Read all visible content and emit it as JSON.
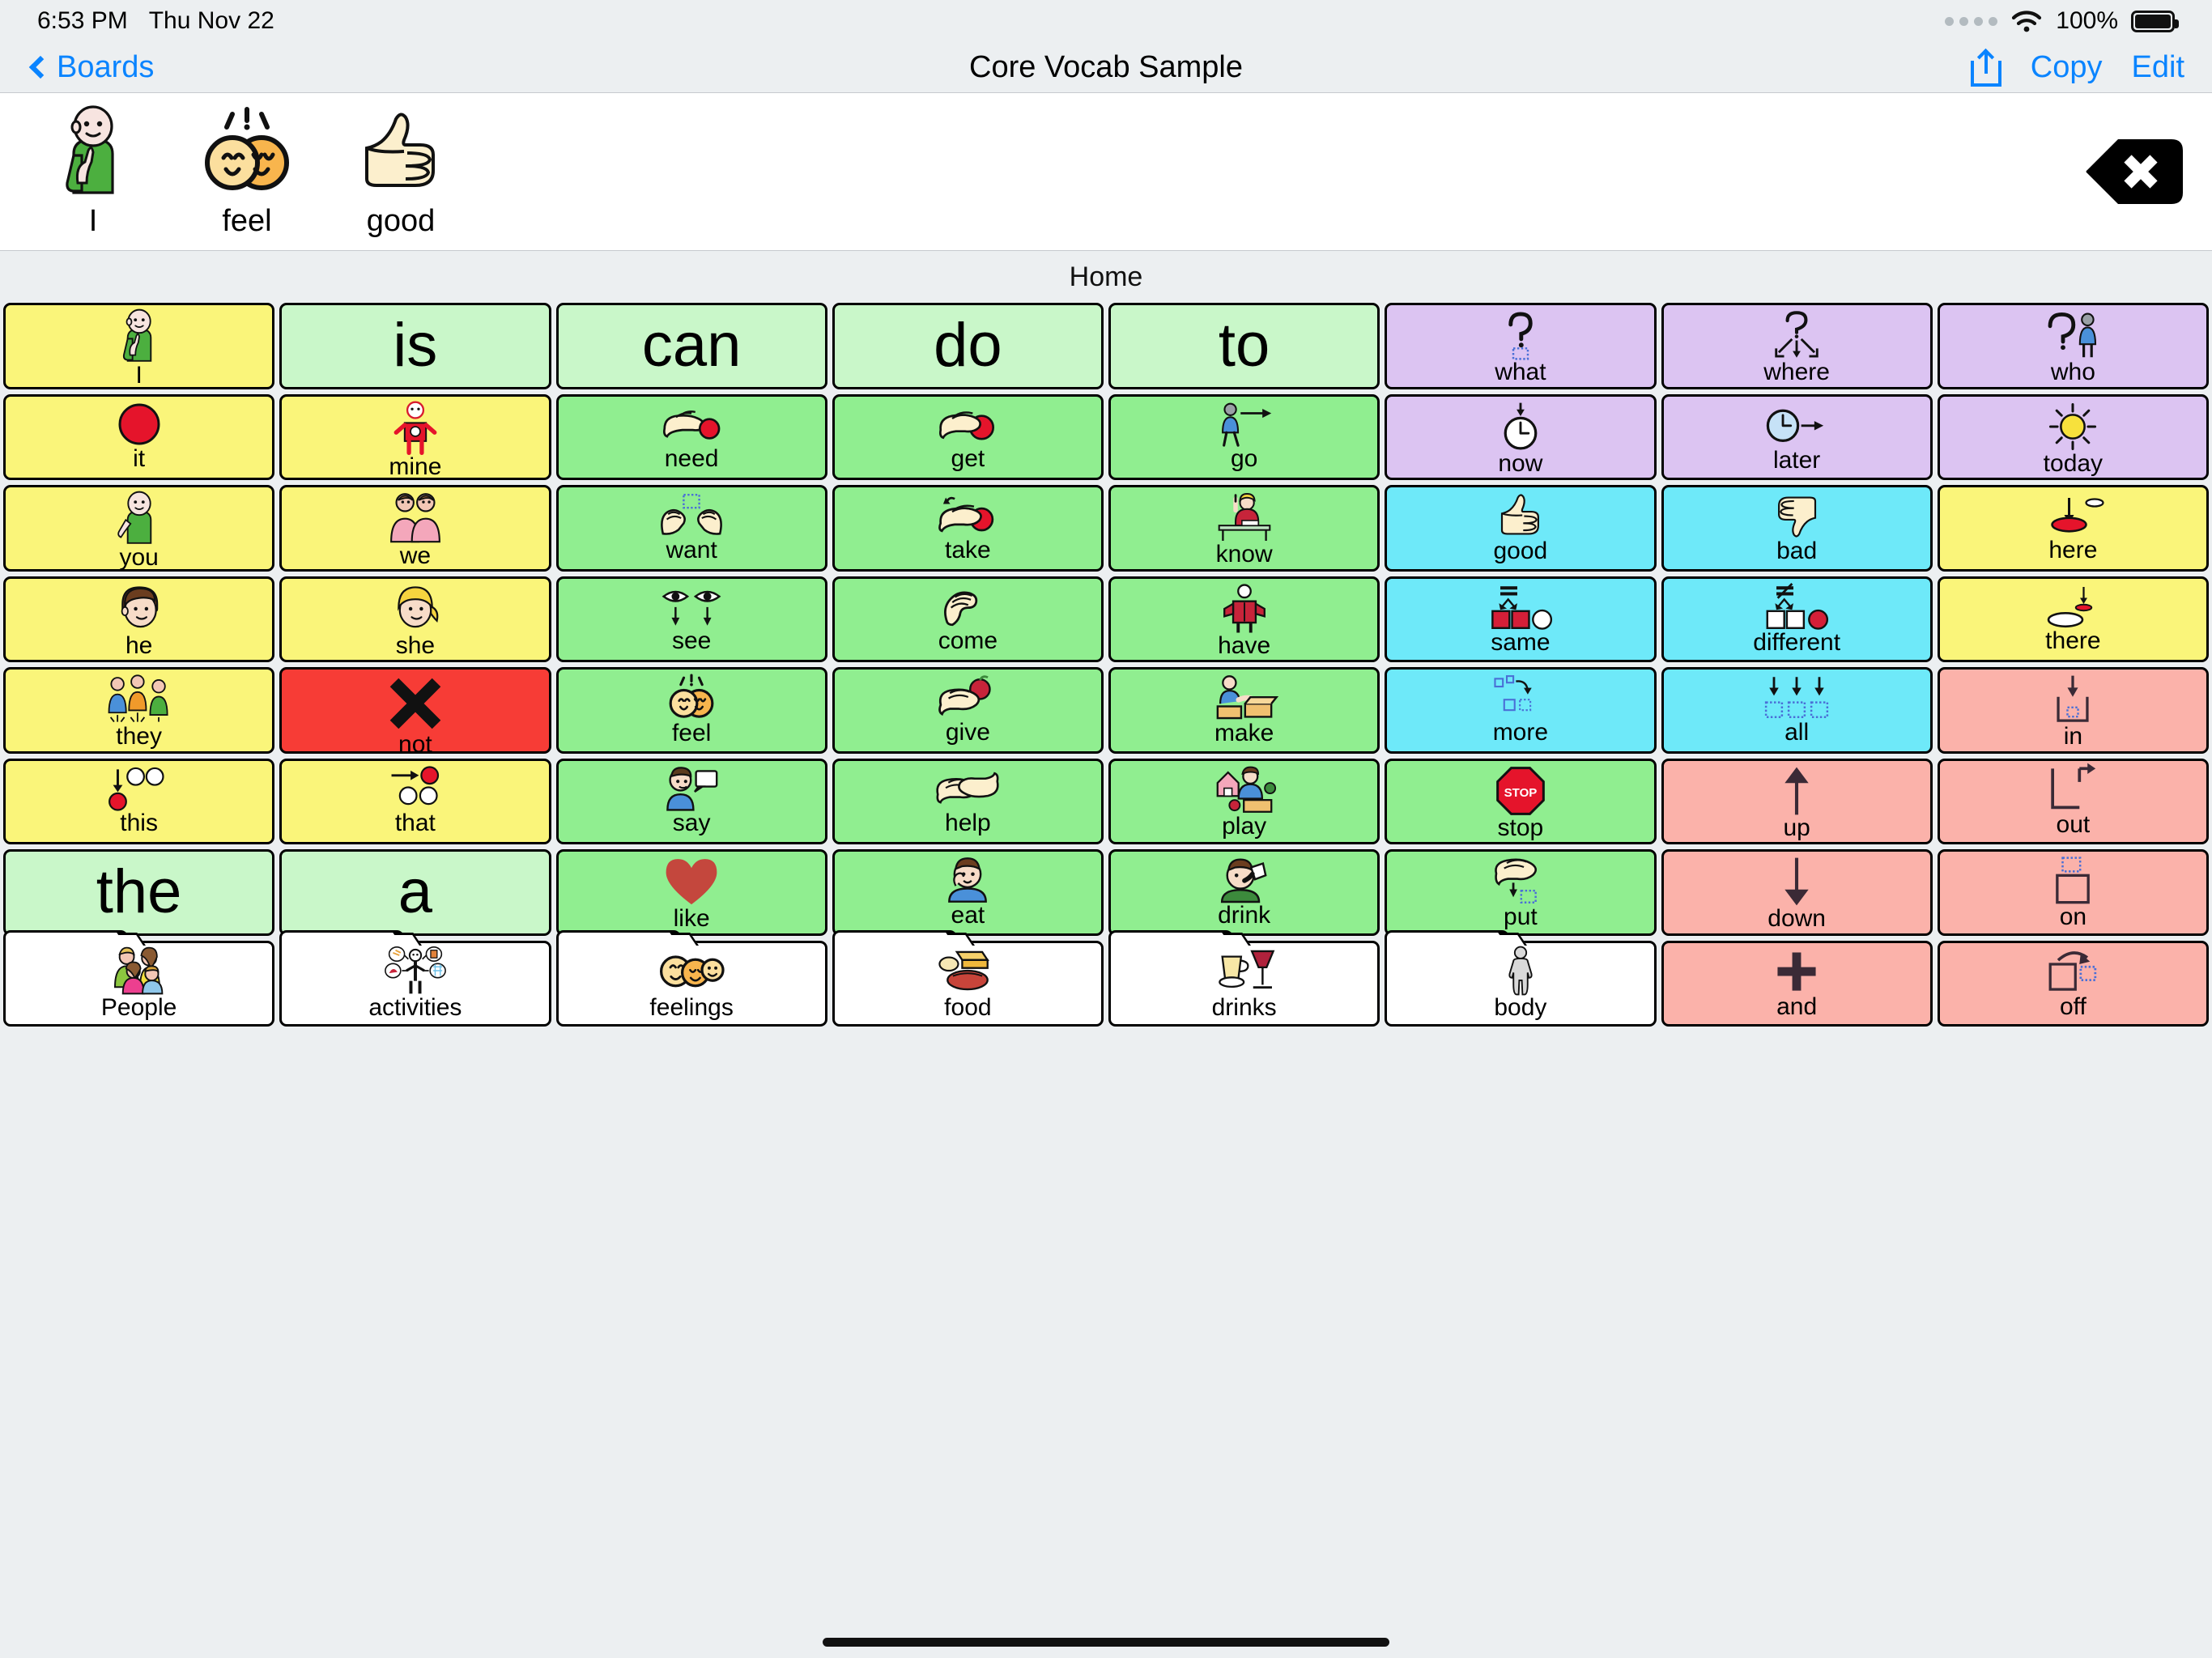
{
  "status_bar": {
    "time": "6:53 PM",
    "date": "Thu Nov 22",
    "battery_percent": "100%",
    "wifi_icon": "wifi-icon",
    "battery_icon": "battery-icon",
    "signal_icon": "signal-dots-icon"
  },
  "nav_bar": {
    "back_label": "Boards",
    "back_icon": "chevron-left-icon",
    "title": "Core Vocab Sample",
    "share_icon": "share-icon",
    "copy_label": "Copy",
    "edit_label": "Edit"
  },
  "message_bar": {
    "items": [
      {
        "label": "I",
        "symbol": "person-pointing-self-symbol"
      },
      {
        "label": "feel",
        "symbol": "two-faces-feeling-symbol"
      },
      {
        "label": "good",
        "symbol": "thumbs-up-symbol"
      }
    ],
    "delete_icon": "backspace-delete-icon"
  },
  "board": {
    "name": "Home",
    "columns": 8,
    "colors": {
      "pronoun_yellow": "#faf57a",
      "article_mint": "#c9f7c9",
      "verb_green": "#90ee90",
      "question_purple": "#dcc4f2",
      "descriptor_cyan": "#6ee9f9",
      "preposition_pink": "#fbb2aa",
      "negation_red": "#f73c36",
      "folder_white": "#ffffff"
    },
    "cells": [
      {
        "label": "I",
        "symbol": "person-pointing-self-symbol",
        "color": "pronoun_yellow",
        "style": "symbol"
      },
      {
        "label": "is",
        "symbol": "",
        "color": "article_mint",
        "style": "word"
      },
      {
        "label": "can",
        "symbol": "",
        "color": "article_mint",
        "style": "word"
      },
      {
        "label": "do",
        "symbol": "",
        "color": "article_mint",
        "style": "word"
      },
      {
        "label": "to",
        "symbol": "",
        "color": "article_mint",
        "style": "word"
      },
      {
        "label": "what",
        "symbol": "question-mark-box-symbol",
        "color": "question_purple",
        "style": "symbol"
      },
      {
        "label": "where",
        "symbol": "question-mark-arrows-symbol",
        "color": "question_purple",
        "style": "symbol"
      },
      {
        "label": "who",
        "symbol": "question-mark-person-symbol",
        "color": "question_purple",
        "style": "symbol"
      },
      {
        "label": "it",
        "symbol": "red-circle-symbol",
        "color": "pronoun_yellow",
        "style": "symbol"
      },
      {
        "label": "mine",
        "symbol": "person-holding-red-symbol",
        "color": "pronoun_yellow",
        "style": "symbol"
      },
      {
        "label": "need",
        "symbol": "hand-reaching-ball-symbol",
        "color": "verb_green",
        "style": "symbol"
      },
      {
        "label": "get",
        "symbol": "hand-grabbing-ball-symbol",
        "color": "verb_green",
        "style": "symbol"
      },
      {
        "label": "go",
        "symbol": "person-walking-arrow-symbol",
        "color": "verb_green",
        "style": "symbol"
      },
      {
        "label": "now",
        "symbol": "clock-down-arrow-symbol",
        "color": "question_purple",
        "style": "symbol"
      },
      {
        "label": "later",
        "symbol": "clock-right-arrow-symbol",
        "color": "question_purple",
        "style": "symbol"
      },
      {
        "label": "today",
        "symbol": "sun-symbol",
        "color": "question_purple",
        "style": "symbol"
      },
      {
        "label": "you",
        "symbol": "person-pointing-out-symbol",
        "color": "pronoun_yellow",
        "style": "symbol"
      },
      {
        "label": "we",
        "symbol": "two-people-symbol",
        "color": "pronoun_yellow",
        "style": "symbol"
      },
      {
        "label": "want",
        "symbol": "two-hands-reaching-symbol",
        "color": "verb_green",
        "style": "symbol"
      },
      {
        "label": "take",
        "symbol": "hand-taking-ball-symbol",
        "color": "verb_green",
        "style": "symbol"
      },
      {
        "label": "know",
        "symbol": "girl-raising-hand-symbol",
        "color": "verb_green",
        "style": "symbol"
      },
      {
        "label": "good",
        "symbol": "thumbs-up-symbol",
        "color": "descriptor_cyan",
        "style": "symbol"
      },
      {
        "label": "bad",
        "symbol": "thumbs-down-symbol",
        "color": "descriptor_cyan",
        "style": "symbol"
      },
      {
        "label": "here",
        "symbol": "arrow-down-red-spot-symbol",
        "color": "pronoun_yellow",
        "style": "symbol"
      },
      {
        "label": "he",
        "symbol": "boy-face-symbol",
        "color": "pronoun_yellow",
        "style": "symbol"
      },
      {
        "label": "she",
        "symbol": "girl-face-symbol",
        "color": "pronoun_yellow",
        "style": "symbol"
      },
      {
        "label": "see",
        "symbol": "eyes-looking-down-symbol",
        "color": "verb_green",
        "style": "symbol"
      },
      {
        "label": "come",
        "symbol": "hand-beckoning-symbol",
        "color": "verb_green",
        "style": "symbol"
      },
      {
        "label": "have",
        "symbol": "person-holding-book-symbol",
        "color": "verb_green",
        "style": "symbol"
      },
      {
        "label": "same",
        "symbol": "equals-two-red-squares-symbol",
        "color": "descriptor_cyan",
        "style": "symbol"
      },
      {
        "label": "different",
        "symbol": "not-equals-shapes-symbol",
        "color": "descriptor_cyan",
        "style": "symbol"
      },
      {
        "label": "there",
        "symbol": "arrow-down-distant-spot-symbol",
        "color": "pronoun_yellow",
        "style": "symbol"
      },
      {
        "label": "they",
        "symbol": "group-of-people-symbol",
        "color": "pronoun_yellow",
        "style": "symbol"
      },
      {
        "label": "not",
        "symbol": "black-x-symbol",
        "color": "negation_red",
        "style": "symbol"
      },
      {
        "label": "feel",
        "symbol": "two-faces-feeling-symbol",
        "color": "verb_green",
        "style": "symbol"
      },
      {
        "label": "give",
        "symbol": "hand-giving-apple-symbol",
        "color": "verb_green",
        "style": "symbol"
      },
      {
        "label": "make",
        "symbol": "person-building-box-symbol",
        "color": "verb_green",
        "style": "symbol"
      },
      {
        "label": "more",
        "symbol": "adding-shapes-symbol",
        "color": "descriptor_cyan",
        "style": "symbol"
      },
      {
        "label": "all",
        "symbol": "three-down-arrows-boxes-symbol",
        "color": "descriptor_cyan",
        "style": "symbol"
      },
      {
        "label": "in",
        "symbol": "arrow-into-box-symbol",
        "color": "preposition_pink",
        "style": "symbol"
      },
      {
        "label": "this",
        "symbol": "arrow-down-near-circles-symbol",
        "color": "pronoun_yellow",
        "style": "symbol"
      },
      {
        "label": "that",
        "symbol": "arrow-right-far-circles-symbol",
        "color": "pronoun_yellow",
        "style": "symbol"
      },
      {
        "label": "say",
        "symbol": "person-speech-bubble-symbol",
        "color": "verb_green",
        "style": "symbol"
      },
      {
        "label": "help",
        "symbol": "helping-hands-symbol",
        "color": "verb_green",
        "style": "symbol"
      },
      {
        "label": "play",
        "symbol": "child-playing-toys-symbol",
        "color": "verb_green",
        "style": "symbol"
      },
      {
        "label": "stop",
        "symbol": "stop-sign-symbol",
        "color": "verb_green",
        "style": "symbol"
      },
      {
        "label": "up",
        "symbol": "arrow-up-symbol",
        "color": "preposition_pink",
        "style": "symbol"
      },
      {
        "label": "out",
        "symbol": "arrow-out-of-box-symbol",
        "color": "preposition_pink",
        "style": "symbol"
      },
      {
        "label": "the",
        "symbol": "",
        "color": "article_mint",
        "style": "word"
      },
      {
        "label": "a",
        "symbol": "",
        "color": "article_mint",
        "style": "word"
      },
      {
        "label": "like",
        "symbol": "red-heart-symbol",
        "color": "verb_green",
        "style": "symbol"
      },
      {
        "label": "eat",
        "symbol": "person-eating-symbol",
        "color": "verb_green",
        "style": "symbol"
      },
      {
        "label": "drink",
        "symbol": "person-drinking-symbol",
        "color": "verb_green",
        "style": "symbol"
      },
      {
        "label": "put",
        "symbol": "hand-putting-down-symbol",
        "color": "verb_green",
        "style": "symbol"
      },
      {
        "label": "down",
        "symbol": "arrow-down-symbol",
        "color": "preposition_pink",
        "style": "symbol"
      },
      {
        "label": "on",
        "symbol": "box-on-top-symbol",
        "color": "preposition_pink",
        "style": "symbol"
      },
      {
        "label": "People",
        "symbol": "family-group-symbol",
        "color": "folder_white",
        "style": "folder"
      },
      {
        "label": "activities",
        "symbol": "person-activities-symbol",
        "color": "folder_white",
        "style": "folder"
      },
      {
        "label": "feelings",
        "symbol": "three-faces-symbol",
        "color": "folder_white",
        "style": "folder"
      },
      {
        "label": "food",
        "symbol": "food-plate-symbol",
        "color": "folder_white",
        "style": "folder"
      },
      {
        "label": "drinks",
        "symbol": "drinks-glasses-symbol",
        "color": "folder_white",
        "style": "folder"
      },
      {
        "label": "body",
        "symbol": "human-body-symbol",
        "color": "folder_white",
        "style": "folder"
      },
      {
        "label": "and",
        "symbol": "plus-sign-symbol",
        "color": "preposition_pink",
        "style": "symbol"
      },
      {
        "label": "off",
        "symbol": "box-lifting-off-symbol",
        "color": "preposition_pink",
        "style": "symbol"
      }
    ]
  },
  "home_indicator": "home-indicator-bar"
}
